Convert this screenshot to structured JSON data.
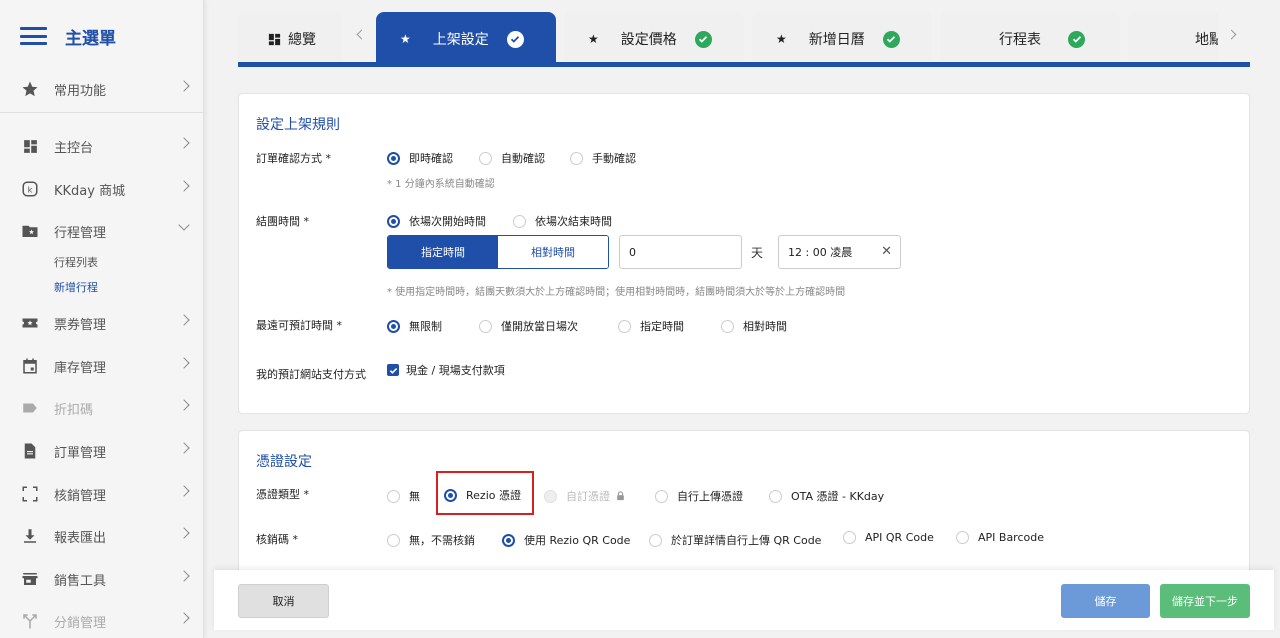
{
  "sidebar": {
    "title": "主選單",
    "items": [
      {
        "label": "常用功能"
      },
      {
        "label": "主控台"
      },
      {
        "label": "KKday 商城"
      },
      {
        "label": "行程管理"
      },
      {
        "label": "票券管理"
      },
      {
        "label": "庫存管理"
      },
      {
        "label": "折扣碼"
      },
      {
        "label": "訂單管理"
      },
      {
        "label": "核銷管理"
      },
      {
        "label": "報表匯出"
      },
      {
        "label": "銷售工具"
      },
      {
        "label": "分銷管理"
      }
    ],
    "subitems": [
      {
        "label": "行程列表"
      },
      {
        "label": "新增行程"
      }
    ]
  },
  "tabs": [
    {
      "label": "總覽"
    },
    {
      "label": "上架設定"
    },
    {
      "label": "設定價格"
    },
    {
      "label": "新增日曆"
    },
    {
      "label": "行程表"
    },
    {
      "label": "地點"
    }
  ],
  "listing": {
    "title": "設定上架規則",
    "confirm_label": "訂單確認方式 *",
    "confirm_options": [
      "即時確認",
      "自動確認",
      "手動確認"
    ],
    "confirm_note": "* 1 分鐘內系統自動確認",
    "cutoff_label": "結團時間 *",
    "cutoff_options": [
      "依場次開始時間",
      "依場次結束時間"
    ],
    "seg_specified": "指定時間",
    "seg_relative": "相對時間",
    "days_value": "0",
    "days_unit": "天",
    "time_value": "12 : 00 凌晨",
    "cutoff_note": "* 使用指定時間時，結團天數須大於上方確認時間；使用相對時間時，結團時間須大於等於上方確認時間",
    "advance_label": "最遠可預訂時間 *",
    "advance_options": [
      "無限制",
      "僅開放當日場次",
      "指定時間",
      "相對時間"
    ],
    "payment_label": "我的預訂網站支付方式",
    "payment_option": "現金 / 現場支付款項"
  },
  "voucher": {
    "title": "憑證設定",
    "type_label": "憑證類型 *",
    "type_options": [
      "無",
      "Rezio 憑證",
      "自訂憑證",
      "自行上傳憑證",
      "OTA 憑證 - KKday"
    ],
    "code_label": "核銷碼 *",
    "code_options": [
      "無，不需核銷",
      "使用 Rezio QR Code",
      "於訂單詳情自行上傳 QR Code",
      "API QR Code",
      "API Barcode"
    ]
  },
  "footer": {
    "cancel": "取消",
    "save": "儲存",
    "save_next": "儲存並下一步"
  }
}
